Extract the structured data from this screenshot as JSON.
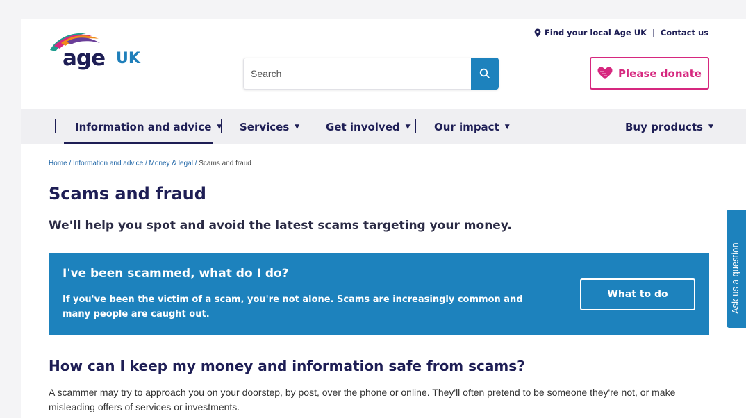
{
  "header": {
    "logo_primary": "age",
    "logo_secondary": "UK",
    "search_placeholder": "Search",
    "toplinks": [
      "Find your local Age UK",
      "Contact us"
    ],
    "donate_label": "Please donate"
  },
  "nav": {
    "items": [
      {
        "label": "Information and advice",
        "icon": "chevron-down-icon",
        "active": true
      },
      {
        "label": "Services",
        "icon": "chevron-down-icon"
      },
      {
        "label": "Get involved",
        "icon": "chevron-down-icon"
      },
      {
        "label": "Our impact",
        "icon": "chevron-down-icon"
      },
      {
        "label": "Buy products",
        "icon": "chevron-down-icon"
      }
    ]
  },
  "breadcrumb": {
    "items": [
      "Home",
      "Information and advice",
      "Money & legal"
    ],
    "current": "Scams and fraud",
    "separator": " / "
  },
  "main": {
    "title": "Scams and fraud",
    "intro": "We'll help you spot and avoid the latest scams targeting your money.",
    "callout": {
      "heading": "I've been scammed, what do I do?",
      "text": "If you've been the victim of a scam, you're not alone. Scams are increasingly common and many people are caught out.",
      "button": "What to do"
    },
    "section_heading": "How can I keep my money and information safe from scams?",
    "section_text": "A scammer may try to approach you on your doorstep, by post, over the phone or online. They'll often pretend to be someone they're not, or make misleading offers of services or investments."
  },
  "ask_tab": "Ask us a question",
  "colors": {
    "brand_navy": "#1e1e55",
    "brand_blue": "#1d82bd",
    "donate_pink": "#d6287f"
  }
}
